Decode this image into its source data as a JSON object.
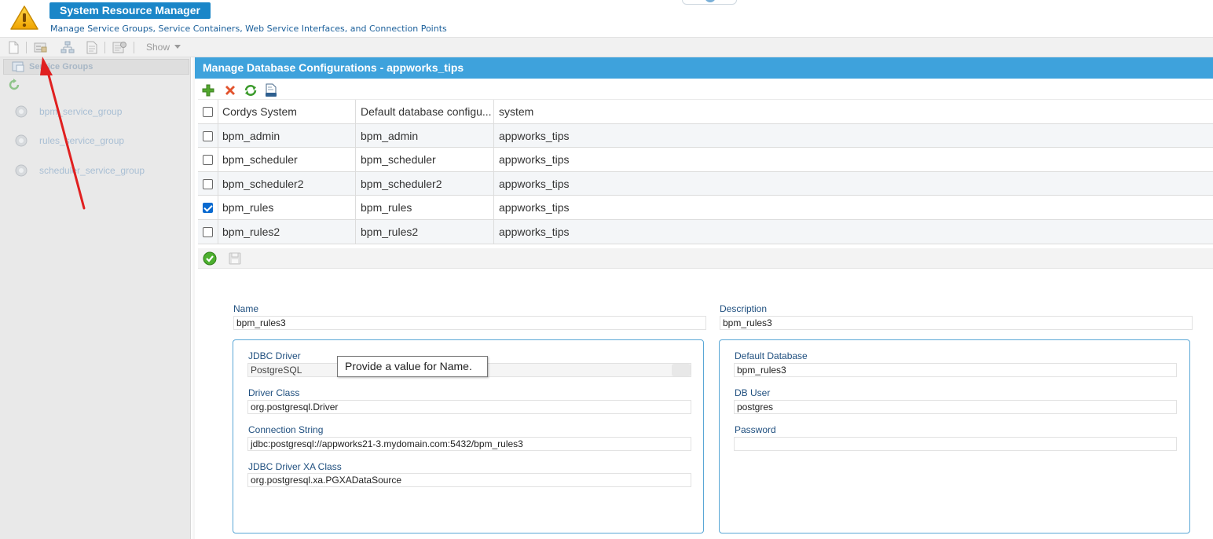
{
  "header": {
    "title": "System Resource Manager",
    "subtitle": "Manage Service Groups, Service Containers, Web Service Interfaces, and Connection Points"
  },
  "toolbar": {
    "icons": [
      "new-icon",
      "service-container-icon",
      "hierarchy-icon",
      "document-icon",
      "properties-icon"
    ],
    "show_label": "Show"
  },
  "sidebar": {
    "header_label": "Service Groups",
    "items": [
      {
        "label": "bpm_service_group"
      },
      {
        "label": "rules_service_group"
      },
      {
        "label": "scheduler_service_group"
      }
    ]
  },
  "panel": {
    "title": "Manage Database Configurations - appworks_tips"
  },
  "grid": {
    "columns": [
      "Cordys System",
      "Default database configu...",
      "system"
    ],
    "rows": [
      {
        "name": "bpm_admin",
        "config": "bpm_admin",
        "system": "appworks_tips",
        "checked": false
      },
      {
        "name": "bpm_scheduler",
        "config": "bpm_scheduler",
        "system": "appworks_tips",
        "checked": false
      },
      {
        "name": "bpm_scheduler2",
        "config": "bpm_scheduler2",
        "system": "appworks_tips",
        "checked": false
      },
      {
        "name": "bpm_rules",
        "config": "bpm_rules",
        "system": "appworks_tips",
        "checked": true
      },
      {
        "name": "bpm_rules2",
        "config": "bpm_rules2",
        "system": "appworks_tips",
        "checked": false
      }
    ]
  },
  "form": {
    "name_label": "Name",
    "name_value": "bpm_rules3",
    "description_label": "Description",
    "description_value": "bpm_rules3",
    "jdbc_driver_label": "JDBC Driver",
    "jdbc_driver_value": "PostgreSQL",
    "driver_class_label": "Driver Class",
    "driver_class_value": "org.postgresql.Driver",
    "connection_string_label": "Connection String",
    "connection_string_value": "jdbc:postgresql://appworks21-3.mydomain.com:5432/bpm_rules3",
    "xa_class_label": "JDBC Driver XA Class",
    "xa_class_value": "org.postgresql.xa.PGXADataSource",
    "default_db_label": "Default Database",
    "default_db_value": "bpm_rules3",
    "db_user_label": "DB User",
    "db_user_value": "postgres",
    "password_label": "Password",
    "password_value": ""
  },
  "tooltip": {
    "text": "Provide a value for Name."
  },
  "colors": {
    "title_blue": "#1a86c8",
    "panel_header": "#3ea2dc",
    "annotation_arrow": "#e02020"
  }
}
